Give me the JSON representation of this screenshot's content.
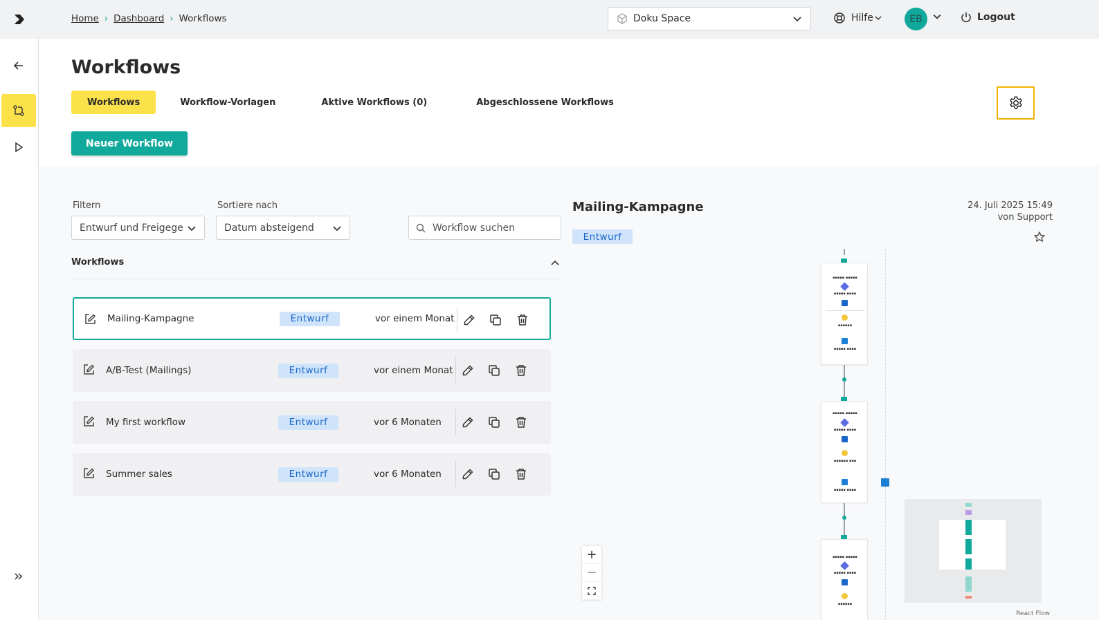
{
  "colors": {
    "accent": "#12a99d",
    "highlight": "#fbe14a",
    "badge_bg": "#cfe4fb",
    "badge_text": "#1b66c9",
    "focus_border": "#f0b400"
  },
  "topbar": {
    "breadcrumb": {
      "home": "Home",
      "dashboard": "Dashboard",
      "current": "Workflows"
    },
    "space": {
      "label": "Doku Space",
      "icon": "cube-icon"
    },
    "help": "Hilfe",
    "avatar": "EB",
    "logout": "Logout"
  },
  "sidebar": {
    "items": [
      {
        "icon": "back-arrow-icon"
      },
      {
        "icon": "workflow-icon",
        "active": true
      },
      {
        "icon": "play-icon"
      },
      {
        "icon": "expand-icon"
      }
    ]
  },
  "header": {
    "title": "Workflows",
    "tabs": [
      {
        "label": "Workflows",
        "active": true
      },
      {
        "label": "Workflow-Vorlagen"
      },
      {
        "label": "Aktive Workflows (0)"
      },
      {
        "label": "Abgeschlossene Workflows"
      }
    ],
    "new_button": "Neuer Workflow"
  },
  "filters": {
    "filter_label": "Filtern",
    "filter_value": "Entwurf und Freigege",
    "sort_label": "Sortiere nach",
    "sort_value": "Datum absteigend",
    "search_placeholder": "Workflow suchen"
  },
  "list": {
    "section_title": "Workflows",
    "rows": [
      {
        "name": "Mailing-Kampagne",
        "status": "Entwurf",
        "date": "vor einem Monat",
        "selected": true
      },
      {
        "name": "A/B-Test (Mailings)",
        "status": "Entwurf",
        "date": "vor einem Monat"
      },
      {
        "name": "My first workflow",
        "status": "Entwurf",
        "date": "vor 6 Monaten"
      },
      {
        "name": "Summer sales",
        "status": "Entwurf",
        "date": "vor 6 Monaten"
      }
    ]
  },
  "detail": {
    "title": "Mailing-Kampagne",
    "date": "24. Juli 2025 15:49",
    "author": "von Support",
    "status": "Entwurf",
    "attribution": "React Flow",
    "zoom_controls": [
      "+",
      "−"
    ]
  }
}
